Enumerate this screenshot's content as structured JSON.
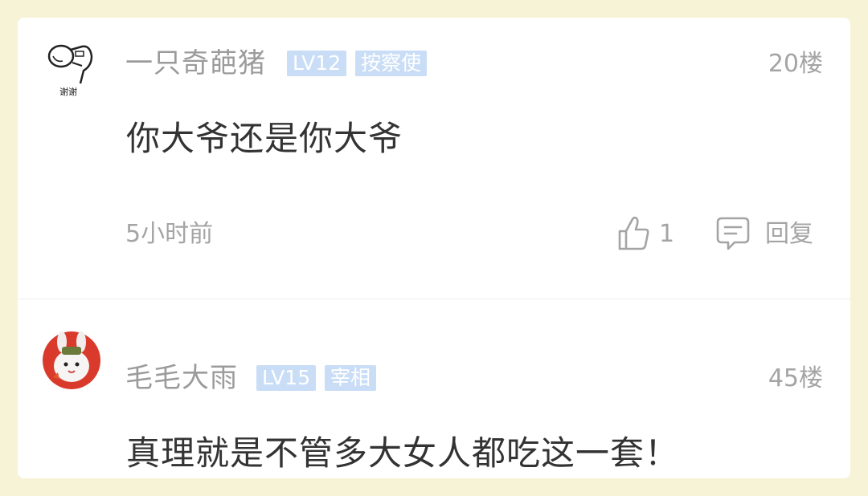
{
  "comments": [
    {
      "username": "一只奇葩猪",
      "level": "LV12",
      "title": "按察使",
      "floor": "20楼",
      "content": "你大爷还是你大爷",
      "time": "5小时前",
      "likes": "1",
      "reply_label": "回复",
      "avatar": {
        "icon": "hairdryer-sketch-icon",
        "caption": "谢谢"
      }
    },
    {
      "username": "毛毛大雨",
      "level": "LV15",
      "title": "宰相",
      "floor": "45楼",
      "content": "真理就是不管多大女人都吃这一套！",
      "avatar": {
        "icon": "rabbit-soldier-icon"
      }
    }
  ],
  "colors": {
    "page_bg": "#f7f3d6",
    "badge_bg": "#c9ddf6",
    "badge_text": "#ffffff",
    "username": "#9b9b9b",
    "content": "#333333",
    "meta": "#a4a4a4"
  }
}
